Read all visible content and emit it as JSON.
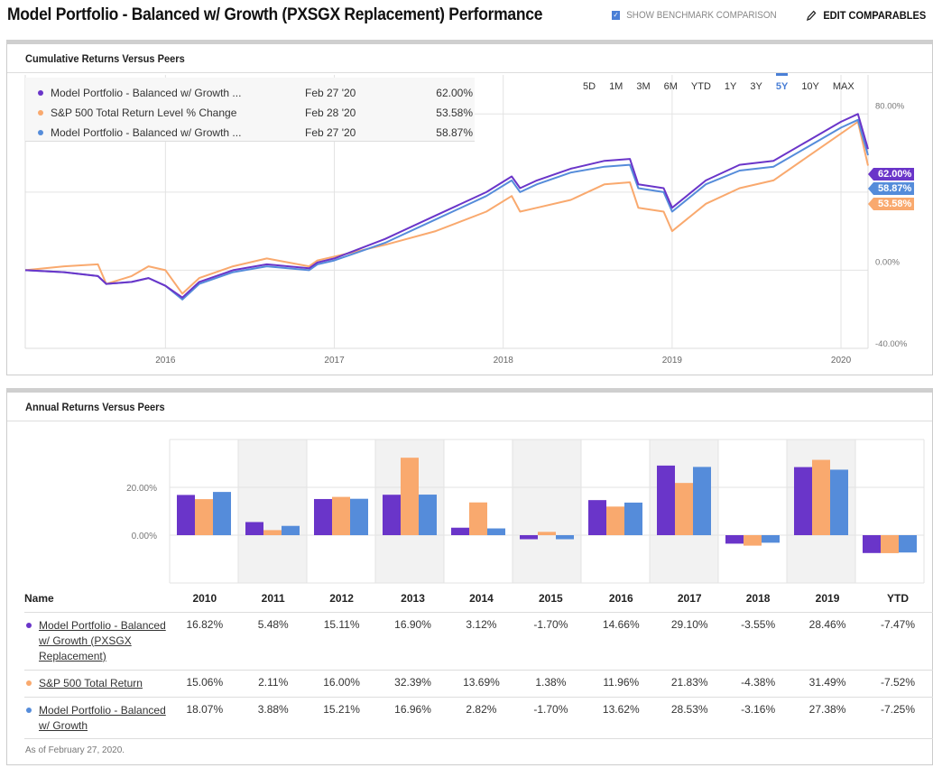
{
  "page": {
    "title": "Model Portfolio - Balanced w/ Growth (PXSGX Replacement) Performance",
    "benchmark_checkbox_label": "SHOW BENCHMARK COMPARISON",
    "benchmark_checked": true,
    "edit_comparables_label": "EDIT COMPARABLES"
  },
  "colors": {
    "purple": "#6a35c9",
    "orange": "#f9a96e",
    "blue": "#558cda"
  },
  "cumulative": {
    "heading": "Cumulative Returns Versus Peers",
    "legend": [
      {
        "name": "Model Portfolio - Balanced w/ Growth ...",
        "date": "Feb 27 '20",
        "value": "62.00%",
        "color": "#6a35c9"
      },
      {
        "name": "S&P 500 Total Return Level % Change",
        "date": "Feb 28 '20",
        "value": "53.58%",
        "color": "#f9a96e"
      },
      {
        "name": "Model Portfolio - Balanced w/ Growth ...",
        "date": "Feb 27 '20",
        "value": "58.87%",
        "color": "#558cda"
      }
    ],
    "ranges": [
      "5D",
      "1M",
      "3M",
      "6M",
      "YTD",
      "1Y",
      "3Y",
      "5Y",
      "10Y",
      "MAX"
    ],
    "active_range": "5Y",
    "end_tags": [
      "62.00%",
      "58.87%",
      "53.58%"
    ]
  },
  "annual": {
    "heading": "Annual Returns Versus Peers",
    "name_header": "Name",
    "columns": [
      "2010",
      "2011",
      "2012",
      "2013",
      "2014",
      "2015",
      "2016",
      "2017",
      "2018",
      "2019",
      "YTD"
    ],
    "rows": [
      {
        "name": "Model Portfolio - Balanced w/ Growth (PXSGX Replacement)",
        "color": "#6a35c9",
        "values": [
          "16.82%",
          "5.48%",
          "15.11%",
          "16.90%",
          "3.12%",
          "-1.70%",
          "14.66%",
          "29.10%",
          "-3.55%",
          "28.46%",
          "-7.47%"
        ]
      },
      {
        "name": "S&P 500 Total Return",
        "color": "#f9a96e",
        "values": [
          "15.06%",
          "2.11%",
          "16.00%",
          "32.39%",
          "13.69%",
          "1.38%",
          "11.96%",
          "21.83%",
          "-4.38%",
          "31.49%",
          "-7.52%"
        ]
      },
      {
        "name": "Model Portfolio - Balanced w/ Growth",
        "color": "#558cda",
        "values": [
          "18.07%",
          "3.88%",
          "15.21%",
          "16.96%",
          "2.82%",
          "-1.70%",
          "13.62%",
          "28.53%",
          "-3.16%",
          "27.38%",
          "-7.25%"
        ]
      }
    ],
    "as_of": "As of February 27, 2020."
  },
  "chart_data": [
    {
      "type": "line",
      "title": "Cumulative Returns Versus Peers",
      "xlabel": "",
      "ylabel": "",
      "x_ticks": [
        "2016",
        "2017",
        "2018",
        "2019",
        "2020"
      ],
      "y_ticks": [
        "80.00%",
        "0.00%",
        "-40.00%"
      ],
      "ylim": [
        -40,
        100
      ],
      "x_range_years": [
        2015.17,
        2020.16
      ],
      "grid": true,
      "series": [
        {
          "name": "Model Portfolio - Balanced w/ Growth (PXSGX Replacement)",
          "color": "#6a35c9",
          "x": [
            2015.17,
            2015.4,
            2015.6,
            2015.65,
            2015.8,
            2015.9,
            2016.0,
            2016.1,
            2016.2,
            2016.4,
            2016.6,
            2016.85,
            2016.9,
            2017.0,
            2017.3,
            2017.6,
            2017.9,
            2018.05,
            2018.1,
            2018.2,
            2018.4,
            2018.6,
            2018.75,
            2018.8,
            2018.95,
            2019.0,
            2019.2,
            2019.4,
            2019.6,
            2019.8,
            2020.0,
            2020.1,
            2020.16
          ],
          "y": [
            0,
            -1,
            -3,
            -7,
            -6,
            -4,
            -8,
            -14,
            -6,
            0,
            3,
            1,
            4,
            6,
            16,
            28,
            40,
            48,
            42,
            46,
            52,
            56,
            57,
            44,
            42,
            32,
            46,
            54,
            56,
            66,
            76,
            80,
            62.0
          ]
        },
        {
          "name": "S&P 500 Total Return Level % Change",
          "color": "#f9a96e",
          "x": [
            2015.17,
            2015.4,
            2015.6,
            2015.65,
            2015.8,
            2015.9,
            2016.0,
            2016.1,
            2016.2,
            2016.4,
            2016.6,
            2016.85,
            2016.9,
            2017.0,
            2017.3,
            2017.6,
            2017.9,
            2018.05,
            2018.1,
            2018.2,
            2018.4,
            2018.6,
            2018.75,
            2018.8,
            2018.95,
            2019.0,
            2019.2,
            2019.4,
            2019.6,
            2019.8,
            2020.0,
            2020.1,
            2020.16
          ],
          "y": [
            0,
            2,
            3,
            -7,
            -3,
            2,
            0,
            -12,
            -4,
            2,
            6,
            2,
            5,
            7,
            13,
            20,
            30,
            38,
            30,
            32,
            36,
            44,
            45,
            32,
            30,
            20,
            34,
            42,
            46,
            58,
            70,
            76,
            53.58
          ]
        },
        {
          "name": "Model Portfolio - Balanced w/ Growth",
          "color": "#558cda",
          "x": [
            2015.17,
            2015.4,
            2015.6,
            2015.65,
            2015.8,
            2015.9,
            2016.0,
            2016.1,
            2016.2,
            2016.4,
            2016.6,
            2016.85,
            2016.9,
            2017.0,
            2017.3,
            2017.6,
            2017.9,
            2018.05,
            2018.1,
            2018.2,
            2018.4,
            2018.6,
            2018.75,
            2018.8,
            2018.95,
            2019.0,
            2019.2,
            2019.4,
            2019.6,
            2019.8,
            2020.0,
            2020.1,
            2020.16
          ],
          "y": [
            0,
            -1,
            -3,
            -7,
            -6,
            -4,
            -8,
            -15,
            -7,
            -1,
            2,
            0,
            3,
            5,
            14,
            26,
            38,
            46,
            40,
            44,
            50,
            53,
            54,
            42,
            40,
            30,
            44,
            51,
            53,
            63,
            73,
            77,
            58.87
          ]
        }
      ]
    },
    {
      "type": "bar",
      "title": "Annual Returns Versus Peers",
      "categories": [
        "2010",
        "2011",
        "2012",
        "2013",
        "2014",
        "2015",
        "2016",
        "2017",
        "2018",
        "2019",
        "YTD"
      ],
      "y_ticks": [
        "20.00%",
        "0.00%"
      ],
      "ylim": [
        -20,
        40
      ],
      "grid": true,
      "series": [
        {
          "name": "Model Portfolio - Balanced w/ Growth (PXSGX Replacement)",
          "color": "#6a35c9",
          "values": [
            16.82,
            5.48,
            15.11,
            16.9,
            3.12,
            -1.7,
            14.66,
            29.1,
            -3.55,
            28.46,
            -7.47
          ]
        },
        {
          "name": "S&P 500 Total Return",
          "color": "#f9a96e",
          "values": [
            15.06,
            2.11,
            16.0,
            32.39,
            13.69,
            1.38,
            11.96,
            21.83,
            -4.38,
            31.49,
            -7.52
          ]
        },
        {
          "name": "Model Portfolio - Balanced w/ Growth",
          "color": "#558cda",
          "values": [
            18.07,
            3.88,
            15.21,
            16.96,
            2.82,
            -1.7,
            13.62,
            28.53,
            -3.16,
            27.38,
            -7.25
          ]
        }
      ]
    }
  ]
}
